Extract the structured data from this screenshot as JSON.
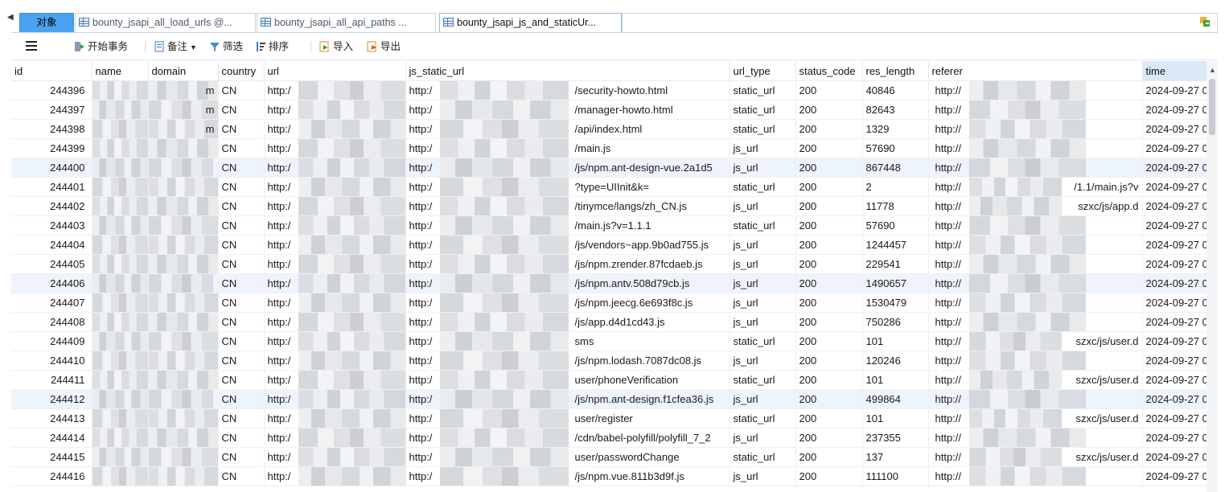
{
  "tabs": [
    {
      "label": "对象",
      "type": "objects"
    },
    {
      "label": "bounty_jsapi_all_load_urls @...",
      "type": "table"
    },
    {
      "label": "bounty_jsapi_all_api_paths ...",
      "type": "table"
    },
    {
      "label": "bounty_jsapi_js_and_staticUr...",
      "type": "table",
      "active": true
    }
  ],
  "toolbar": {
    "menu_icon": "hamburger-menu-icon",
    "begin_transaction": "开始事务",
    "note": "备注",
    "filter": "筛选",
    "sort": "排序",
    "import": "导入",
    "export": "导出"
  },
  "columns": [
    "id",
    "name",
    "domain",
    "country",
    "url",
    "js_static_url",
    "url_type",
    "status_code",
    "res_length",
    "referer",
    "time"
  ],
  "rows": [
    {
      "id": "244396",
      "domain_suffix": "m",
      "country": "CN",
      "url": "http:/",
      "js_lead": "http:/",
      "js_suffix": "/security-howto.html",
      "url_type": "static_url",
      "status_code": "200",
      "res_length": "40846",
      "ref_lead": "http://",
      "ref_suffix": "",
      "time": "2024-09-27 0"
    },
    {
      "id": "244397",
      "domain_suffix": "m",
      "country": "CN",
      "url": "http:/",
      "js_lead": "http:/",
      "js_suffix": "/manager-howto.html",
      "url_type": "static_url",
      "status_code": "200",
      "res_length": "82643",
      "ref_lead": "http://",
      "ref_suffix": "",
      "time": "2024-09-27 0"
    },
    {
      "id": "244398",
      "domain_suffix": "m",
      "country": "CN",
      "url": "http:/",
      "js_lead": "http:/",
      "js_suffix": "/api/index.html",
      "url_type": "static_url",
      "status_code": "200",
      "res_length": "1329",
      "ref_lead": "http://",
      "ref_suffix": "",
      "time": "2024-09-27 0"
    },
    {
      "id": "244399",
      "domain_suffix": "",
      "country": "CN",
      "url": "http:/",
      "js_lead": "http:/",
      "js_suffix": "/main.js",
      "url_type": "js_url",
      "status_code": "200",
      "res_length": "57690",
      "ref_lead": "http://",
      "ref_suffix": "",
      "time": "2024-09-27 0"
    },
    {
      "id": "244400",
      "domain_suffix": "",
      "country": "CN",
      "url": "http:/",
      "js_lead": "http:/",
      "js_suffix": "/js/npm.ant-design-vue.2a1d5",
      "url_type": "js_url",
      "status_code": "200",
      "res_length": "867448",
      "ref_lead": "http://",
      "ref_suffix": "",
      "time": "2024-09-27 0",
      "hl": true
    },
    {
      "id": "244401",
      "domain_suffix": "",
      "country": "CN",
      "url": "http:/",
      "js_lead": "http:/",
      "js_suffix": "?type=UIInit&k=",
      "url_type": "static_url",
      "status_code": "200",
      "res_length": "2",
      "ref_lead": "http://",
      "ref_suffix": "/1.1/main.js?v",
      "time": "2024-09-27 0"
    },
    {
      "id": "244402",
      "domain_suffix": "",
      "country": "CN",
      "url": "http:/",
      "js_lead": "http:/",
      "js_suffix": "/tinymce/langs/zh_CN.js",
      "url_type": "js_url",
      "status_code": "200",
      "res_length": "11778",
      "ref_lead": "http://",
      "ref_suffix": "szxc/js/app.d",
      "time": "2024-09-27 0"
    },
    {
      "id": "244403",
      "domain_suffix": "",
      "country": "CN",
      "url": "http:/",
      "js_lead": "http:/",
      "js_suffix": "/main.js?v=1.1.1",
      "url_type": "static_url",
      "status_code": "200",
      "res_length": "57690",
      "ref_lead": "http://",
      "ref_suffix": "",
      "time": "2024-09-27 0"
    },
    {
      "id": "244404",
      "domain_suffix": "",
      "country": "CN",
      "url": "http:/",
      "js_lead": "http:/",
      "js_suffix": "/js/vendors~app.9b0ad755.js",
      "url_type": "js_url",
      "status_code": "200",
      "res_length": "1244457",
      "ref_lead": "http://",
      "ref_suffix": "",
      "time": "2024-09-27 0"
    },
    {
      "id": "244405",
      "domain_suffix": "",
      "country": "CN",
      "url": "http:/",
      "js_lead": "http:/",
      "js_suffix": "/js/npm.zrender.87fcdaeb.js",
      "url_type": "js_url",
      "status_code": "200",
      "res_length": "229541",
      "ref_lead": "http://",
      "ref_suffix": "",
      "time": "2024-09-27 0"
    },
    {
      "id": "244406",
      "domain_suffix": "",
      "country": "CN",
      "url": "http:/",
      "js_lead": "http:/",
      "js_suffix": "/js/npm.antv.508d79cb.js",
      "url_type": "js_url",
      "status_code": "200",
      "res_length": "1490657",
      "ref_lead": "http://",
      "ref_suffix": "",
      "time": "2024-09-27 0",
      "hl": true
    },
    {
      "id": "244407",
      "domain_suffix": "",
      "country": "CN",
      "url": "http:/",
      "js_lead": "http:/",
      "js_suffix": "/js/npm.jeecg.6e693f8c.js",
      "url_type": "js_url",
      "status_code": "200",
      "res_length": "1530479",
      "ref_lead": "http://",
      "ref_suffix": "",
      "time": "2024-09-27 0"
    },
    {
      "id": "244408",
      "domain_suffix": "",
      "country": "CN",
      "url": "http:/",
      "js_lead": "http:/",
      "js_suffix": "/js/app.d4d1cd43.js",
      "url_type": "js_url",
      "status_code": "200",
      "res_length": "750286",
      "ref_lead": "http://",
      "ref_suffix": "",
      "time": "2024-09-27 0"
    },
    {
      "id": "244409",
      "domain_suffix": "",
      "country": "CN",
      "url": "http:/",
      "js_lead": "http:/",
      "js_suffix": "sms",
      "url_type": "static_url",
      "status_code": "200",
      "res_length": "101",
      "ref_lead": "http://",
      "ref_suffix": "szxc/js/user.d",
      "time": "2024-09-27 0"
    },
    {
      "id": "244410",
      "domain_suffix": "",
      "country": "CN",
      "url": "http:/",
      "js_lead": "http:/",
      "js_suffix": "/js/npm.lodash.7087dc08.js",
      "url_type": "js_url",
      "status_code": "200",
      "res_length": "120246",
      "ref_lead": "http://",
      "ref_suffix": "",
      "time": "2024-09-27 0"
    },
    {
      "id": "244411",
      "domain_suffix": "",
      "country": "CN",
      "url": "http:/",
      "js_lead": "http:/",
      "js_suffix": "user/phoneVerification",
      "url_type": "static_url",
      "status_code": "200",
      "res_length": "101",
      "ref_lead": "http://",
      "ref_suffix": "szxc/js/user.d",
      "time": "2024-09-27 0"
    },
    {
      "id": "244412",
      "domain_suffix": "",
      "country": "CN",
      "url": "http:/",
      "js_lead": "http:/",
      "js_suffix": "/js/npm.ant-design.f1cfea36.js",
      "url_type": "js_url",
      "status_code": "200",
      "res_length": "499864",
      "ref_lead": "http://",
      "ref_suffix": "",
      "time": "2024-09-27 0",
      "hl": true
    },
    {
      "id": "244413",
      "domain_suffix": "",
      "country": "CN",
      "url": "http:/",
      "js_lead": "http:/",
      "js_suffix": "user/register",
      "url_type": "static_url",
      "status_code": "200",
      "res_length": "101",
      "ref_lead": "http://",
      "ref_suffix": "szxc/js/user.d",
      "time": "2024-09-27 0"
    },
    {
      "id": "244414",
      "domain_suffix": "",
      "country": "CN",
      "url": "http:/",
      "js_lead": "http:/",
      "js_suffix": "/cdn/babel-polyfill/polyfill_7_2",
      "url_type": "js_url",
      "status_code": "200",
      "res_length": "237355",
      "ref_lead": "http://",
      "ref_suffix": "",
      "time": "2024-09-27 0"
    },
    {
      "id": "244415",
      "domain_suffix": "",
      "country": "CN",
      "url": "http:/",
      "js_lead": "http:/",
      "js_suffix": "user/passwordChange",
      "url_type": "static_url",
      "status_code": "200",
      "res_length": "137",
      "ref_lead": "http://",
      "ref_suffix": "szxc/js/user.d",
      "time": "2024-09-27 0"
    },
    {
      "id": "244416",
      "domain_suffix": "",
      "country": "CN",
      "url": "http:/",
      "js_lead": "http:/",
      "js_suffix": "/js/npm.vue.811b3d9f.js",
      "url_type": "js_url",
      "status_code": "200",
      "res_length": "111100",
      "ref_lead": "http://",
      "ref_suffix": "",
      "time": "2024-09-27 0"
    }
  ],
  "colors": {
    "objects_tab": "#4aa3f0",
    "time_header": "#dbe8f7",
    "row_highlight": "#eef4fc"
  }
}
